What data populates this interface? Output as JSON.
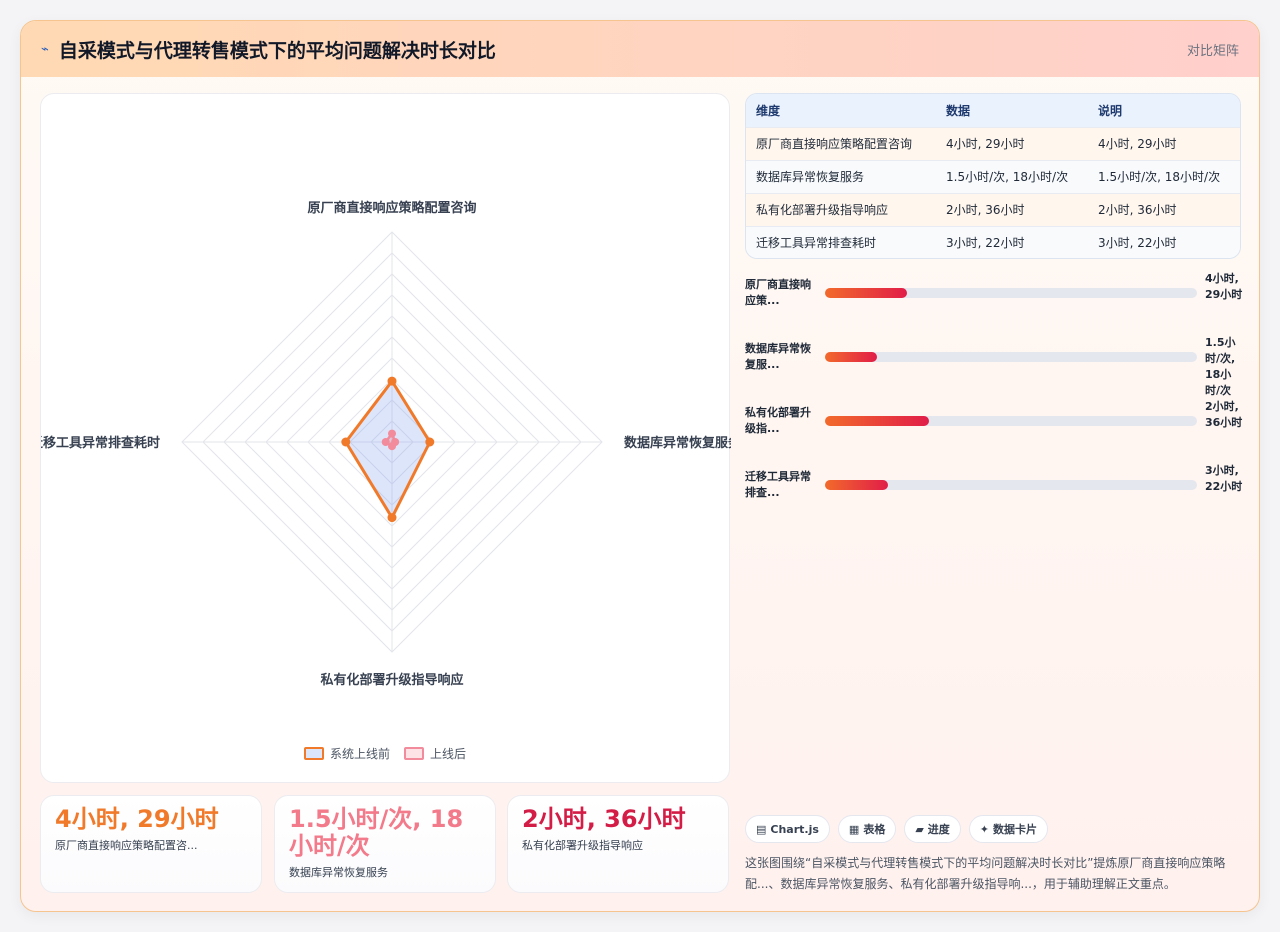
{
  "header": {
    "logo": "⌁",
    "title": "自采模式与代理转售模式下的平均问题解决时长对比",
    "tag": "对比矩阵"
  },
  "chart_data": {
    "type": "radar",
    "categories": [
      "原厂商直接响应策略配置咨询",
      "数据库异常恢复服务",
      "私有化部署升级指导响应",
      "迁移工具异常排查耗时"
    ],
    "series": [
      {
        "name": "系统上线前",
        "values": [
          29,
          18,
          36,
          22
        ],
        "color": "#f07a2a"
      },
      {
        "name": "上线后",
        "values": [
          4,
          1.5,
          2,
          3
        ],
        "color": "#f28b9b"
      }
    ],
    "rmax": 100,
    "grid_rings": 10,
    "legend_position": "bottom"
  },
  "legend": [
    {
      "label": "系统上线前",
      "color": "#f07a2a",
      "fill": "#dbe6fb"
    },
    {
      "label": "上线后",
      "color": "#f28b9b",
      "fill": "#fde2e6"
    }
  ],
  "stats": [
    {
      "value": "4小时, 29小时",
      "label": "原厂商直接响应策略配置咨...",
      "color": "#f07a2a"
    },
    {
      "value": "1.5小时/次, 18小时/次",
      "label": "数据库异常恢复服务",
      "color": "#f27a8a"
    },
    {
      "value": "2小时, 36小时",
      "label": "私有化部署升级指导响应",
      "color": "#d31c46"
    }
  ],
  "table": {
    "headers": [
      "维度",
      "数据",
      "说明"
    ],
    "rows": [
      [
        "原厂商直接响应策略配置咨询",
        "4小时, 29小时",
        "4小时, 29小时"
      ],
      [
        "数据库异常恢复服务",
        "1.5小时/次, 18小时/次",
        "1.5小时/次, 18小时/次"
      ],
      [
        "私有化部署升级指导响应",
        "2小时, 36小时",
        "2小时, 36小时"
      ],
      [
        "迁移工具异常排查耗时",
        "3小时, 22小时",
        "3小时, 22小时"
      ]
    ]
  },
  "bars": [
    {
      "label": "原厂商直接响应策...",
      "value": "4小时, 29小时",
      "fraction": 0.22
    },
    {
      "label": "数据库异常恢复服...",
      "value": "1.5小时/次, 18小时/次",
      "fraction": 0.14
    },
    {
      "label": "私有化部署升级指...",
      "value": "2小时, 36小时",
      "fraction": 0.28
    },
    {
      "label": "迁移工具异常排查...",
      "value": "3小时, 22小时",
      "fraction": 0.17
    }
  ],
  "chips": [
    {
      "icon": "▤",
      "label": "Chart.js"
    },
    {
      "icon": "▦",
      "label": "表格"
    },
    {
      "icon": "▰",
      "label": "进度"
    },
    {
      "icon": "✦",
      "label": "数据卡片"
    }
  ],
  "description": "这张图围绕“自采模式与代理转售模式下的平均问题解决时长对比”提炼原厂商直接响应策略配...、数据库异常恢复服务、私有化部署升级指导响...，用于辅助理解正文重点。"
}
